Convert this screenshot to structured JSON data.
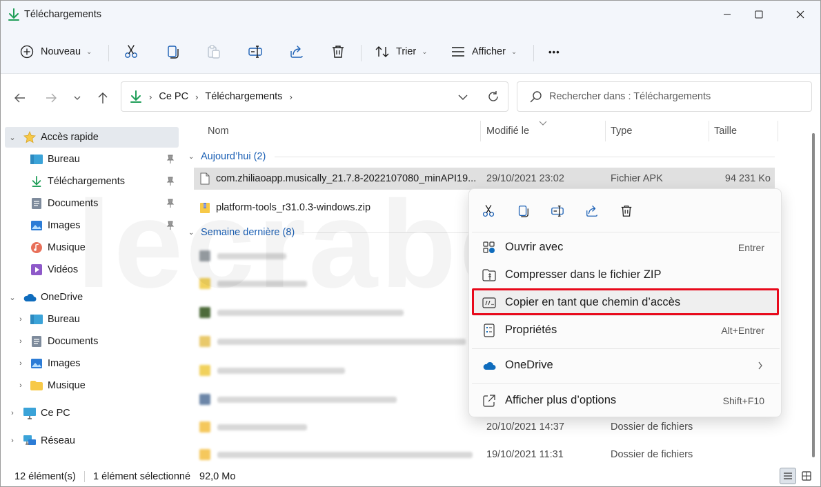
{
  "window": {
    "title": "Téléchargements"
  },
  "toolbar": {
    "new_label": "Nouveau",
    "sort_label": "Trier",
    "view_label": "Afficher",
    "more_label": "•••"
  },
  "address": {
    "crumbs": [
      "Ce PC",
      "Téléchargements"
    ]
  },
  "search": {
    "placeholder": "Rechercher dans : Téléchargements"
  },
  "sidebar": {
    "quick_access": "Accès rapide",
    "quick_items": [
      "Bureau",
      "Téléchargements",
      "Documents",
      "Images",
      "Musique",
      "Vidéos"
    ],
    "onedrive": "OneDrive",
    "onedrive_items": [
      "Bureau",
      "Documents",
      "Images",
      "Musique"
    ],
    "this_pc": "Ce PC",
    "network": "Réseau"
  },
  "columns": {
    "name": "Nom",
    "modified": "Modifié le",
    "type": "Type",
    "size": "Taille"
  },
  "groups": {
    "today": "Aujourd’hui (2)",
    "last_week": "Semaine dernière (8)"
  },
  "files": [
    {
      "name": "com.zhiliaoapp.musically_21.7.8-2022107080_minAPI19...",
      "date": "29/10/2021 23:02",
      "type": "Fichier APK",
      "size": "94 231 Ko"
    },
    {
      "name": "platform-tools_r31.0.3-windows.zip",
      "date": "",
      "type": "",
      "size": ""
    }
  ],
  "visible_last_week": [
    {
      "date": "20/10/2021 14:37",
      "type": "Dossier de fichiers"
    },
    {
      "date": "19/10/2021 11:31",
      "type": "Dossier de fichiers"
    }
  ],
  "context_menu": {
    "items": [
      {
        "label": "Ouvrir avec",
        "shortcut": "Entrer"
      },
      {
        "label": "Compresser dans le fichier ZIP",
        "shortcut": ""
      },
      {
        "label": "Copier en tant que chemin d’accès",
        "shortcut": ""
      },
      {
        "label": "Propriétés",
        "shortcut": "Alt+Entrer"
      },
      {
        "label": "OneDrive",
        "shortcut": ""
      },
      {
        "label": "Afficher plus d’options",
        "shortcut": "Shift+F10"
      }
    ]
  },
  "status": {
    "count": "12 élément(s)",
    "selected": "1 élément sélectionné",
    "size": "92,0 Mo"
  },
  "watermark": "lecrabeinfo",
  "colors": {
    "accent": "#0067c0",
    "highlight_box": "#e8091b",
    "folder": "#f7c948",
    "download_green": "#1f9e58"
  }
}
